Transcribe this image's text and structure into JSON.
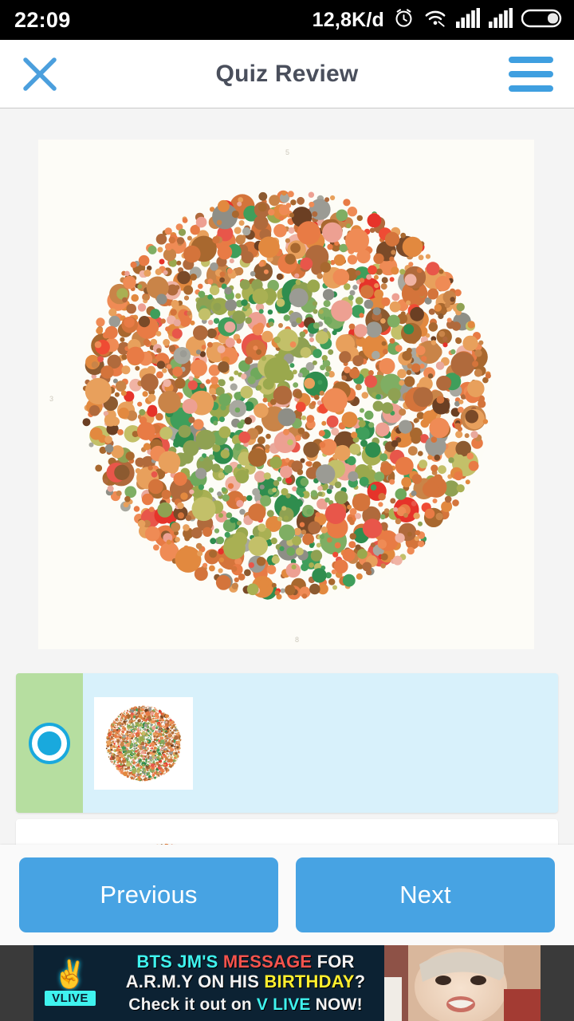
{
  "status_bar": {
    "time": "22:09",
    "data_rate": "12,8K/d",
    "icons": [
      "alarm-icon",
      "wifi-icon",
      "signal-bars-icon-1",
      "signal-bars-icon-2",
      "battery-icon"
    ]
  },
  "app_bar": {
    "title": "Quiz Review",
    "close_icon": "close-icon",
    "menu_icon": "hamburger-menu-icon",
    "accent_color": "#3f9fe0",
    "title_color": "#4a4f5c"
  },
  "question": {
    "image_alt": "ishihara-color-blindness-plate",
    "plate_background": "#fdfcf7",
    "plate_top_mark": "5",
    "plate_left_mark": "3",
    "plate_bottom_mark": "8"
  },
  "answers": {
    "selected_index": 0,
    "selected_color": "#b6de a0",
    "option_highlight_color": "#d8f1fb",
    "radio_color": "#19a9dd",
    "options": [
      {
        "label": "",
        "thumb_alt": "ishihara-plate-thumbnail-1",
        "selected": true
      },
      {
        "label": "",
        "thumb_alt": "ishihara-plate-thumbnail-2",
        "selected": false
      }
    ]
  },
  "navigation": {
    "previous_label": "Previous",
    "next_label": "Next",
    "button_color": "#47a3e3"
  },
  "advertisement": {
    "logo_text": "VLIVE",
    "line1_part1": "BTS JM'S ",
    "line1_part2": "MESSAGE",
    "line1_part3": " FOR",
    "line2_part1": "A.R.M.Y ON HIS ",
    "line2_part2": "BIRTHDAY",
    "line2_part3": "?",
    "line3_part1": "Check it out on ",
    "line3_part2": "V LIVE",
    "line3_part3": " NOW!",
    "background": "#0c2233",
    "cyan": "#3ff3ef",
    "red": "#f4534d",
    "yellow": "#ffef2e"
  }
}
